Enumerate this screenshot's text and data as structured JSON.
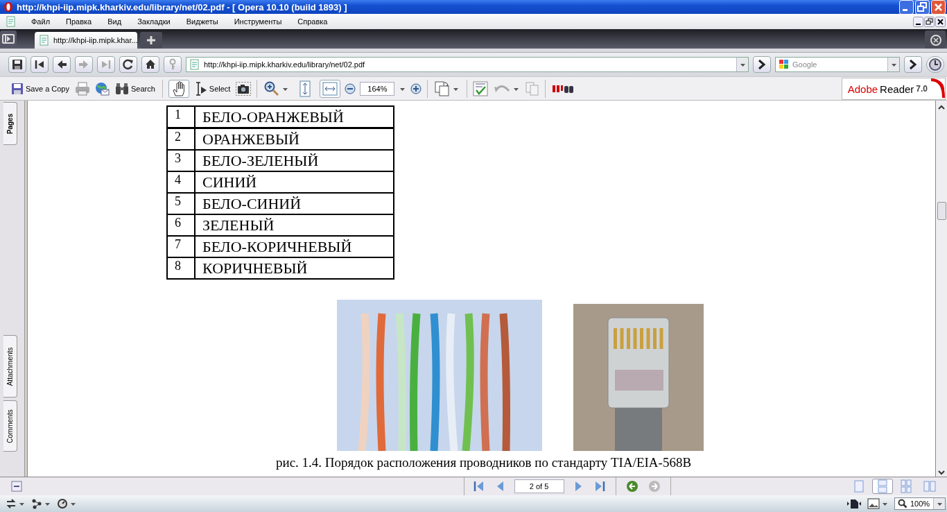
{
  "window": {
    "title": "http://khpi-iip.mipk.kharkiv.edu/library/net/02.pdf - [ Opera 10.10 (build 1893) ]"
  },
  "menu": [
    "Файл",
    "Правка",
    "Вид",
    "Закладки",
    "Виджеты",
    "Инструменты",
    "Справка"
  ],
  "tabs": [
    {
      "label": "http://khpi-iip.mipk.khar...",
      "selected": true
    }
  ],
  "address": {
    "url": "http://khpi-iip.mipk.kharkiv.edu/library/net/02.pdf"
  },
  "search": {
    "placeholder": "Google"
  },
  "reader_toolbar": {
    "save_label": "Save a Copy",
    "search_label": "Search",
    "select_label": "Select",
    "hand_selected": true,
    "fit_width_selected": true,
    "zoom": "164%"
  },
  "brand": {
    "adobe": "Adobe",
    "reader": "Reader",
    "version": "7.0"
  },
  "side_tabs": [
    "Pages",
    "Attachments",
    "Comments"
  ],
  "document": {
    "rows": [
      {
        "number": "1",
        "name": "БЕЛО-ОРАНЖЕВЫЙ"
      },
      {
        "number": "2",
        "name": "ОРАНЖЕВЫЙ"
      },
      {
        "number": "3",
        "name": "БЕЛО-ЗЕЛЕНЫЙ"
      },
      {
        "number": "4",
        "name": "СИНИЙ"
      },
      {
        "number": "5",
        "name": "БЕЛО-СИНИЙ"
      },
      {
        "number": "6",
        "name": "ЗЕЛЕНЫЙ"
      },
      {
        "number": "7",
        "name": "БЕЛО-КОРИЧНЕВЫЙ"
      },
      {
        "number": "8",
        "name": "КОРИЧНЕВЫЙ"
      }
    ],
    "caption": "рис. 1.4. Порядок расположения проводников по стандарту TIA/EIA-568B"
  },
  "page_nav": {
    "page": "2 of 5"
  },
  "page_layouts": [
    {
      "selected": false
    },
    {
      "selected": true
    },
    {
      "selected": false
    },
    {
      "selected": false
    }
  ],
  "status_bar": {
    "zoom": "100%"
  }
}
